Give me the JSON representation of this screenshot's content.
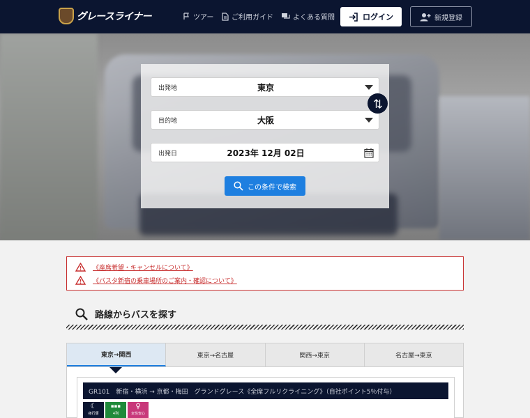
{
  "header": {
    "logo_text": "グレースライナー",
    "nav": [
      {
        "label": "ツアー",
        "icon": "flag-icon"
      },
      {
        "label": "ご利用ガイド",
        "icon": "document-icon"
      },
      {
        "label": "よくある質問",
        "icon": "chat-icon"
      }
    ],
    "login_label": "ログイン",
    "register_label": "新規登録"
  },
  "search": {
    "departure": {
      "label": "出発地",
      "value": "東京"
    },
    "destination": {
      "label": "目的地",
      "value": "大阪"
    },
    "date": {
      "label": "出発日",
      "value": "2023年 12月 02日"
    },
    "submit_label": "この条件で検索"
  },
  "notices": [
    "《座席希望・キャンセルについて》",
    "《バスタ新宿の乗車場所のご案内・確認について》"
  ],
  "section": {
    "title": "路線からバスを探す"
  },
  "tabs": [
    {
      "label": "東京→関西",
      "active": true
    },
    {
      "label": "東京→名古屋",
      "active": false
    },
    {
      "label": "関西→東京",
      "active": false
    },
    {
      "label": "名古屋→東京",
      "active": false
    }
  ],
  "route": {
    "title": "GR101　新宿・横浜 → 京都・梅田　グランドグレース《全席フルリクライニング》（自社ポイント5％付与）",
    "badges": [
      {
        "label": "夜行便",
        "symbol": "☾",
        "color": "#0b1530"
      },
      {
        "label": "4列",
        "symbol": "▪▪▪",
        "color": "#1f8a3a"
      },
      {
        "label": "女性安心",
        "symbol": "♀",
        "color": "#c8387a"
      }
    ]
  },
  "colors": {
    "header_bg": "#0b1530",
    "accent": "#1e7fe0",
    "warning": "#c83030"
  }
}
